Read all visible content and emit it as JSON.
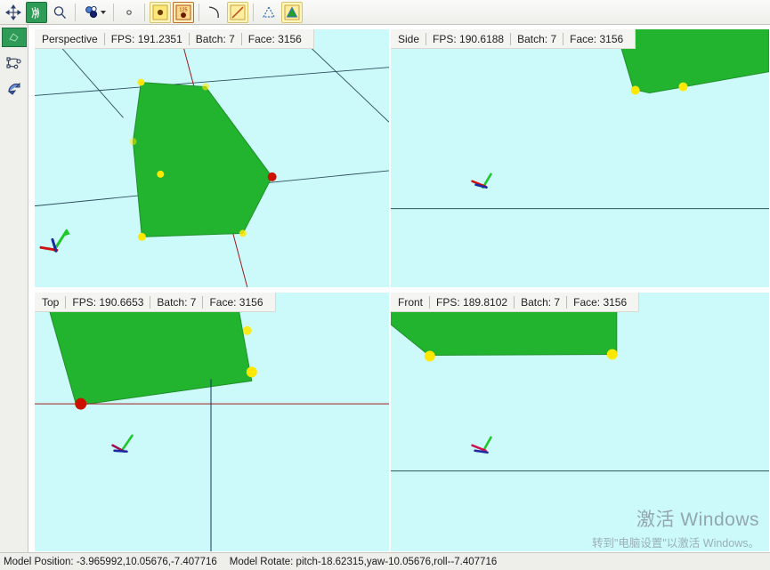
{
  "toolbar": {
    "buttons": [
      {
        "name": "move-tool",
        "icon": "move-cross-icon",
        "state": "normal"
      },
      {
        "name": "select-tool",
        "icon": "brush-stroke-icon",
        "state": "active"
      },
      {
        "name": "zoom-tool",
        "icon": "magnifier-icon",
        "state": "normal"
      },
      {
        "name": "material-tool",
        "icon": "spheres-icon",
        "state": "dropdown"
      },
      {
        "name": "point-size-tool",
        "icon": "small-dot-icon",
        "state": "normal"
      },
      {
        "name": "vertex-tool",
        "icon": "yellow-dot-icon",
        "state": "highlight"
      },
      {
        "name": "numbered-vertex-tool",
        "icon": "numbered-dot-icon",
        "state": "highlight2"
      },
      {
        "name": "curve-tool",
        "icon": "curve-icon",
        "state": "normal"
      },
      {
        "name": "edge-tool",
        "icon": "diagonal-line-icon",
        "state": "highlight"
      },
      {
        "name": "face-outline-tool",
        "icon": "triangle-outline-icon",
        "state": "normal"
      },
      {
        "name": "face-fill-tool",
        "icon": "triangle-filled-icon",
        "state": "highlight"
      }
    ]
  },
  "rail": {
    "thumbnail_label": "model-thumbnail",
    "items": [
      {
        "name": "skeleton-tool",
        "icon": "joint-bone-icon"
      },
      {
        "name": "paint-tool",
        "icon": "rotate-paint-icon"
      }
    ]
  },
  "viewports": [
    {
      "id": "perspective",
      "title": "Perspective",
      "fps_label": "FPS: 191.2351",
      "batch_label": "Batch: 7",
      "face_label": "Face: 3156"
    },
    {
      "id": "side",
      "title": "Side",
      "fps_label": "FPS: 190.6188",
      "batch_label": "Batch: 7",
      "face_label": "Face: 3156"
    },
    {
      "id": "top",
      "title": "Top",
      "fps_label": "FPS: 190.6653",
      "batch_label": "Batch: 7",
      "face_label": "Face: 3156"
    },
    {
      "id": "front",
      "title": "Front",
      "fps_label": "FPS: 189.8102",
      "batch_label": "Batch: 7",
      "face_label": "Face: 3156"
    }
  ],
  "status": {
    "position": "Model Position: -3.965992,10.05676,-7.407716",
    "rotation": "Model Rotate: pitch-18.62315,yaw-10.05676,roll--7.407716"
  },
  "watermark": {
    "line1": "激活 Windows",
    "line2": "转到\"电脑设置\"以激活 Windows。"
  },
  "colors": {
    "viewport_background": "#ccfafa",
    "mesh_fill": "#22b42e",
    "mesh_edge": "#1f8f2a",
    "vertex_handle": "#ffe800",
    "selected_handle": "#cc1100",
    "grid_line": "#2a4a5a",
    "axis_x": "#a01818",
    "axis_y": "#1c9e20",
    "axis_z": "#1b2a9e",
    "toolbar_active": "#2e9b57",
    "header_background": "#f4f4f0"
  }
}
